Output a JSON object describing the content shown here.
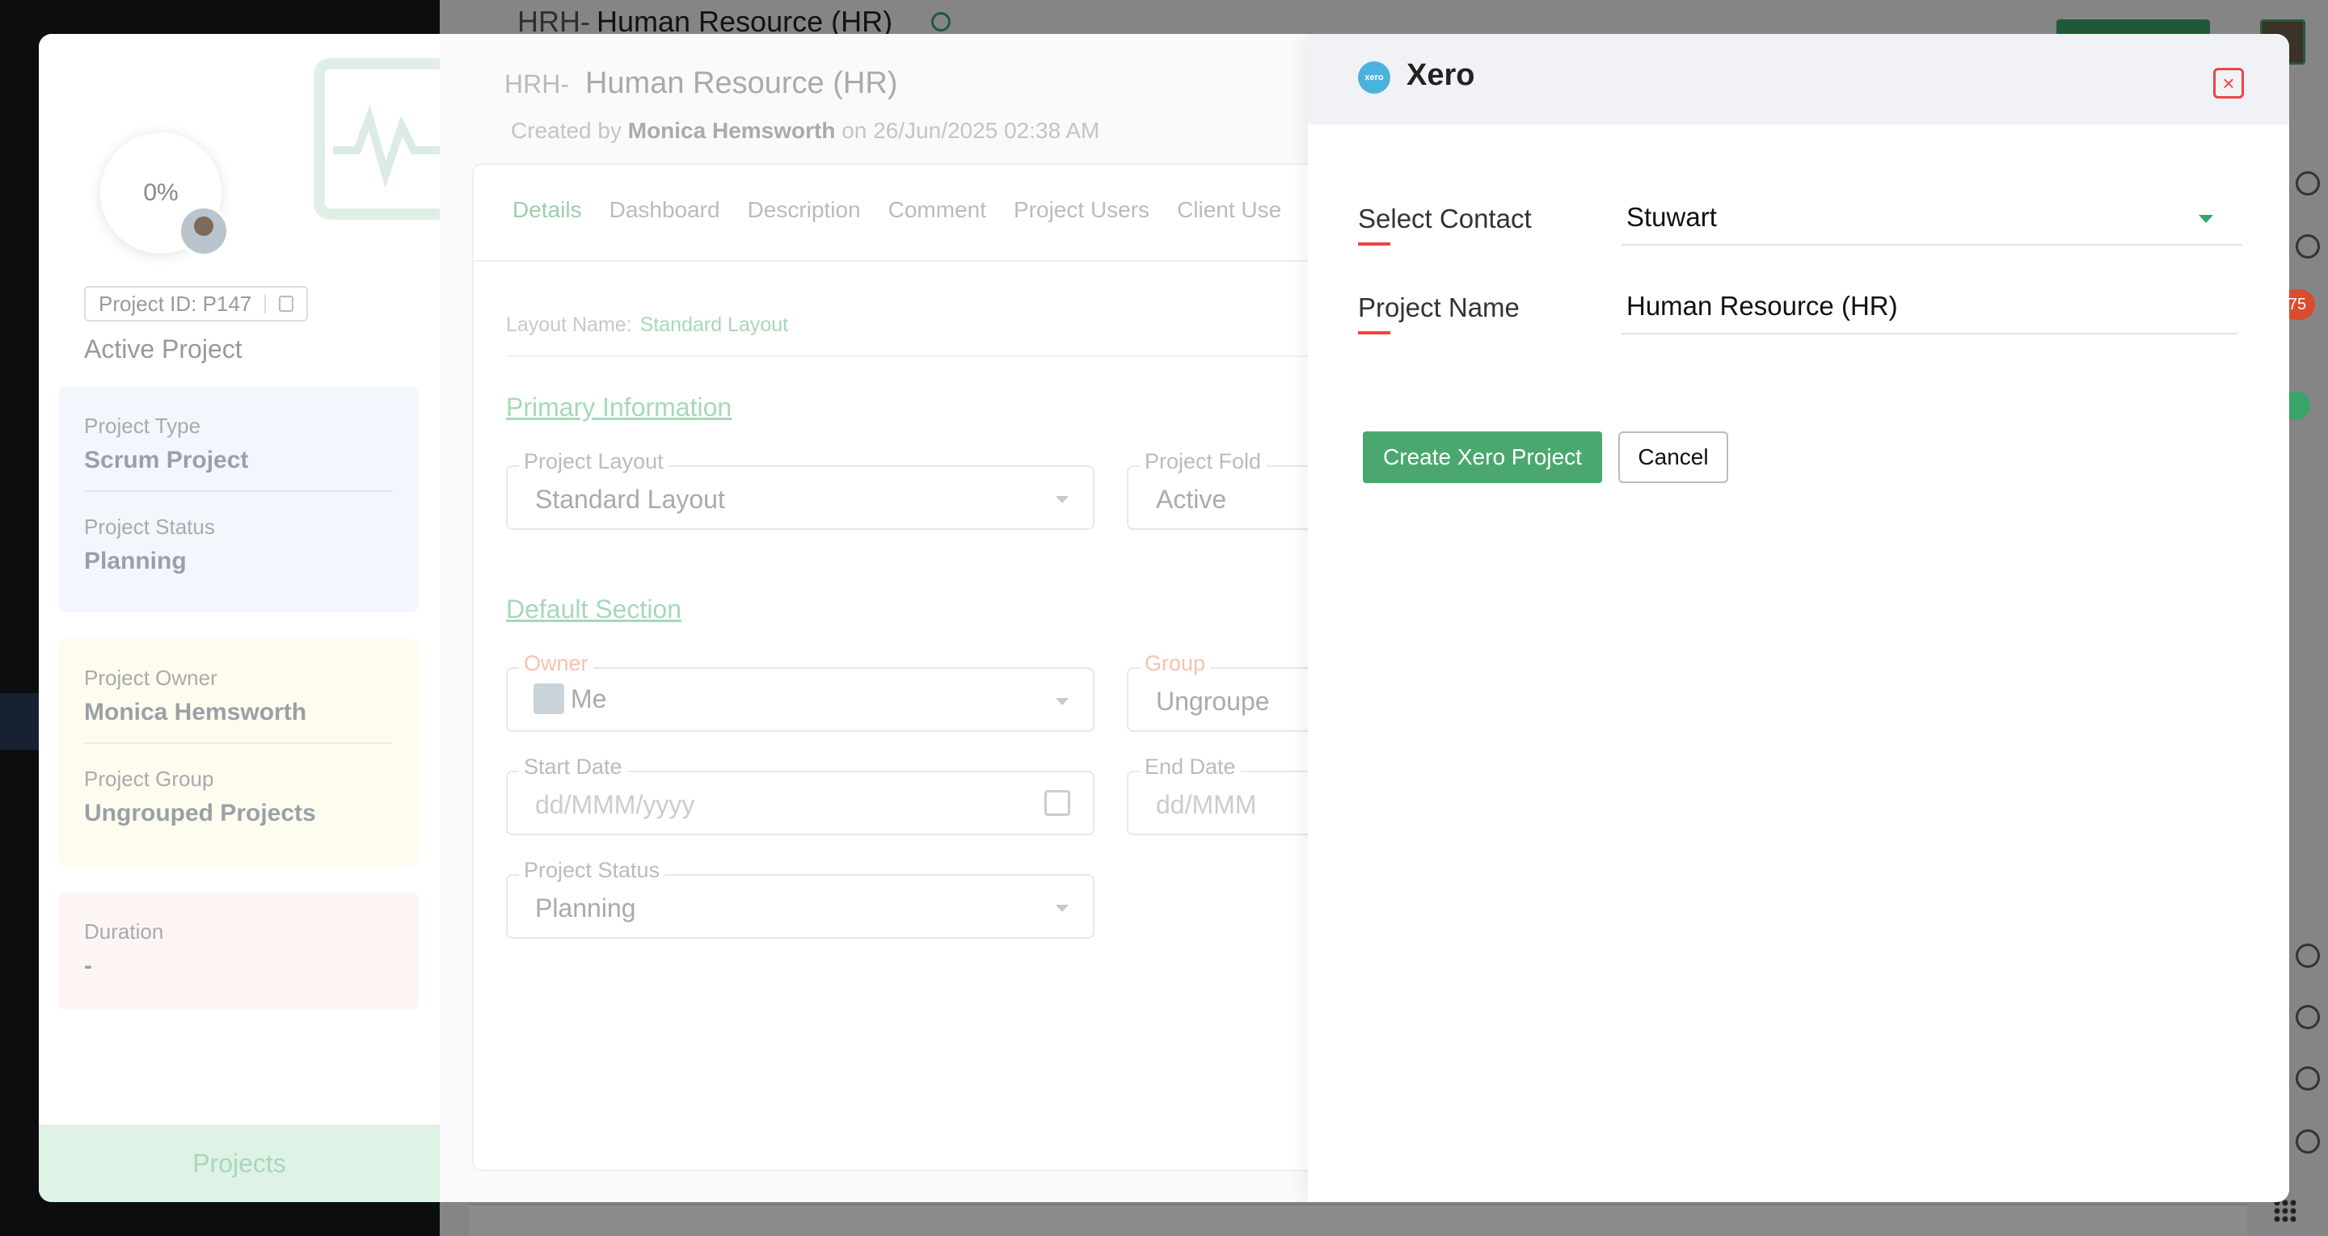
{
  "background": {
    "header_prefix": "HRH-",
    "header_title": "Human Resource (HR)"
  },
  "info_panel": {
    "progress": "0%",
    "project_id": "Project ID: P147",
    "status_label": "Active Project",
    "project_type_label": "Project Type",
    "project_type_value": "Scrum Project",
    "project_status_label": "Project Status",
    "project_status_value": "Planning",
    "project_owner_label": "Project Owner",
    "project_owner_value": "Monica Hemsworth",
    "project_group_label": "Project Group",
    "project_group_value": "Ungrouped Projects",
    "duration_label": "Duration",
    "duration_value": "-",
    "footer": "Projects"
  },
  "details": {
    "prefix": "HRH-",
    "title": "Human Resource (HR)",
    "created_prefix": "Created by",
    "created_by": "Monica Hemsworth",
    "created_on": "on 26/Jun/2025 02:38 AM",
    "tabs": [
      "Details",
      "Dashboard",
      "Description",
      "Comment",
      "Project Users",
      "Client Use"
    ],
    "layout_name_label": "Layout Name:",
    "layout_name_value": "Standard Layout",
    "primary_section": "Primary Information",
    "default_section": "Default Section",
    "fields": {
      "project_layout_label": "Project Layout",
      "project_layout_value": "Standard Layout",
      "project_folder_label": "Project Fold",
      "project_folder_value": "Active",
      "owner_label": "Owner",
      "owner_value": "Me",
      "group_label": "Group",
      "group_value": "Ungroupe",
      "start_date_label": "Start Date",
      "start_date_placeholder": "dd/MMM/yyyy",
      "end_date_label": "End Date",
      "end_date_placeholder": "dd/MMM",
      "status_label": "Project Status",
      "status_value": "Planning"
    }
  },
  "xero": {
    "title": "Xero",
    "logo_text": "xero",
    "select_contact_label": "Select Contact",
    "select_contact_value": "Stuwart",
    "project_name_label": "Project Name",
    "project_name_value": "Human Resource (HR)",
    "create_button": "Create Xero Project",
    "cancel_button": "Cancel",
    "close_icon": "×"
  },
  "edge": {
    "notification_count": "75"
  },
  "colors": {
    "accent_green": "#4aa86f",
    "close_red": "#e44444",
    "xero_blue": "#4ab3dd"
  }
}
